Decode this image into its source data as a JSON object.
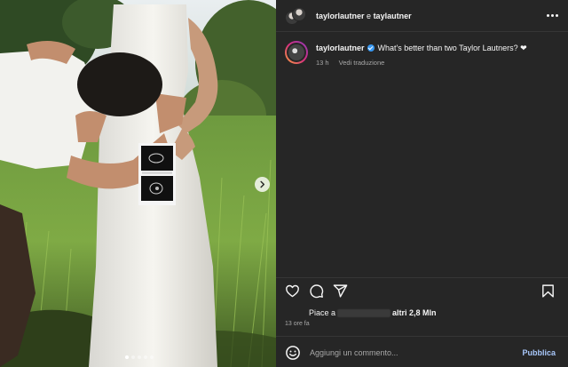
{
  "header": {
    "user_a": "taylorlautner",
    "joiner": "e",
    "user_b": "taylautner",
    "more_icon": "more-horizontal-icon"
  },
  "caption": {
    "username": "taylorlautner",
    "text": "What's better than two Taylor Lautners? ❤",
    "time": "13 h",
    "see_translation": "Vedi traduzione"
  },
  "actions": {
    "like_icon": "heart-icon",
    "comment_icon": "comment-icon",
    "share_icon": "send-icon",
    "save_icon": "bookmark-icon"
  },
  "likes": {
    "prefix": "Piace a",
    "suffix": "altri 2,8 Mln"
  },
  "post_time": "13 ore fa",
  "comment": {
    "placeholder": "Aggiungi un commento...",
    "publish": "Pubblica",
    "emoji_icon": "emoji-icon"
  },
  "carousel": {
    "slides": 5,
    "active_index": 0,
    "next_icon": "chevron-right-icon"
  },
  "colors": {
    "panel_bg": "#262626",
    "verified": "#3897f0",
    "publish": "#a8c7fa"
  }
}
